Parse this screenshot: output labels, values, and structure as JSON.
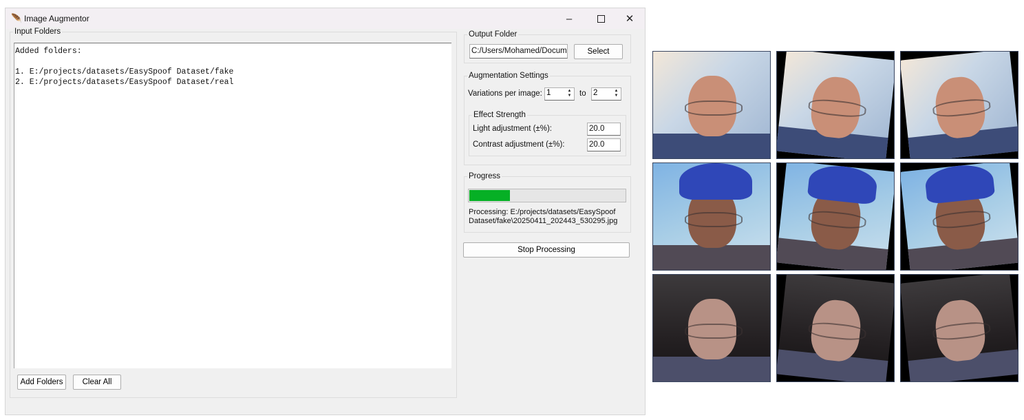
{
  "window": {
    "title": "Image Augmentor",
    "icon": "feather-icon",
    "controls": [
      "minimize-icon",
      "maximize-icon",
      "close-icon"
    ]
  },
  "input_folders": {
    "group_label": "Input Folders",
    "text_lines": [
      "Added folders:",
      "",
      "1. E:/projects/datasets/EasySpoof Dataset/fake",
      "2. E:/projects/datasets/EasySpoof Dataset/real"
    ],
    "add_button": "Add Folders",
    "clear_button": "Clear All"
  },
  "output_folder": {
    "group_label": "Output Folder",
    "path_value": "C:/Users/Mohamed/Documents",
    "select_button": "Select"
  },
  "augmentation": {
    "group_label": "Augmentation Settings",
    "variations_label": "Variations per image:",
    "variations_from": "1",
    "to_label": "to",
    "variations_to": "2",
    "effect": {
      "group_label": "Effect Strength",
      "light_label": "Light adjustment (±%):",
      "light_value": "20.0",
      "contrast_label": "Contrast adjustment (±%):",
      "contrast_value": "20.0"
    }
  },
  "progress": {
    "group_label": "Progress",
    "fraction": 0.26,
    "bar_color": "#06b025",
    "status_line1": "Processing: E:/projects/datasets/EasySpoof",
    "status_line2": "Dataset/fake\\20250411_202443_530295.jpg"
  },
  "stop_button": "Stop Processing",
  "preview_grid": {
    "rows": [
      [
        "original",
        "rotated",
        "rotated"
      ],
      [
        "original",
        "rotated",
        "rotated"
      ],
      [
        "original",
        "rotated",
        "rotated"
      ]
    ]
  }
}
